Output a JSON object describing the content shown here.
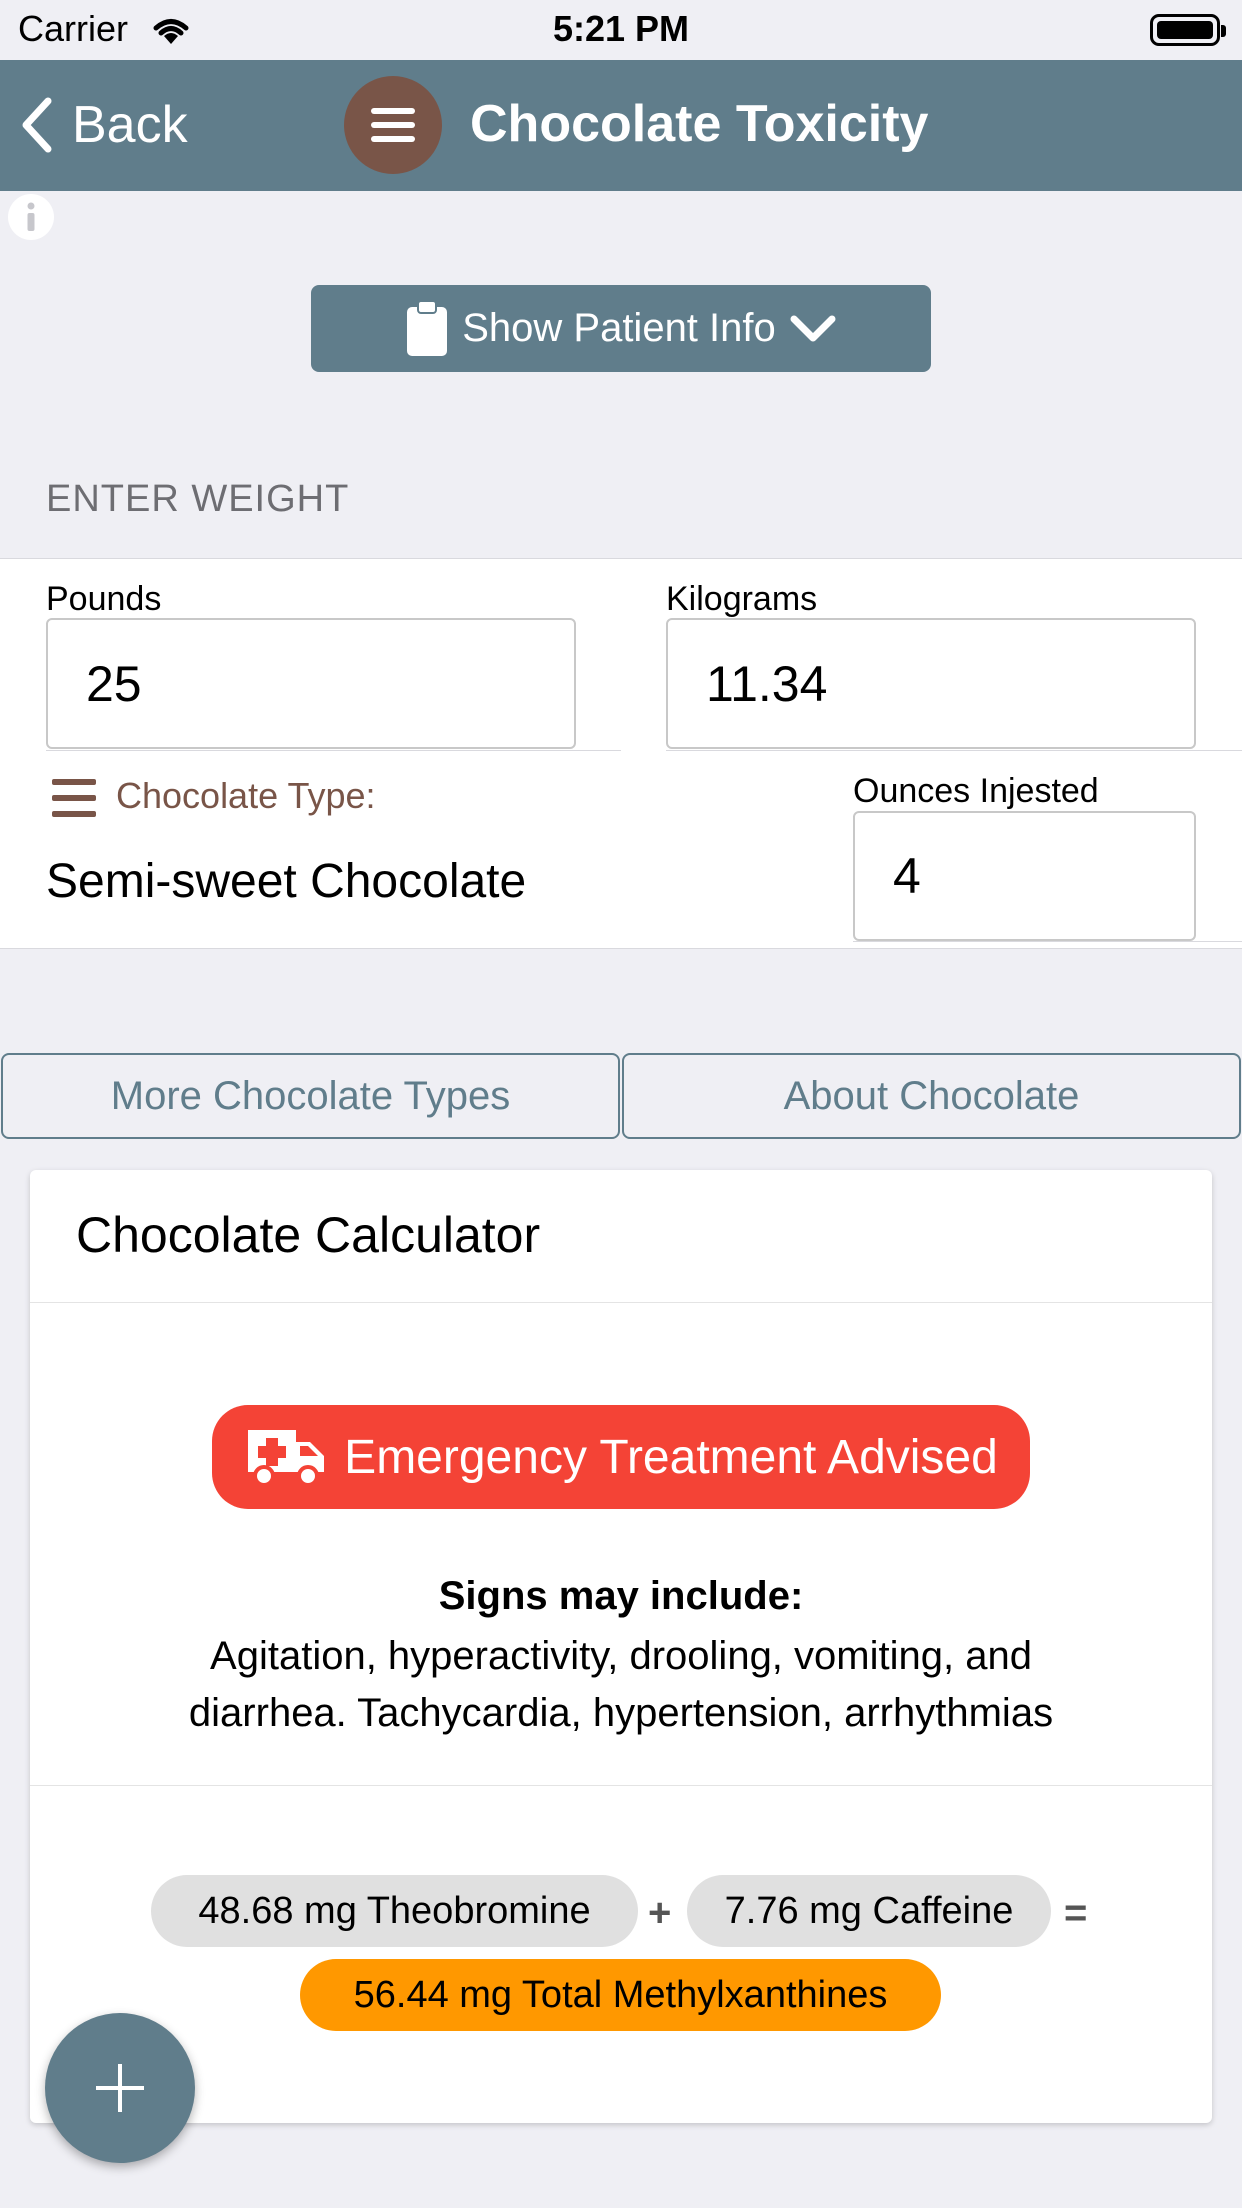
{
  "status_bar": {
    "carrier": "Carrier",
    "time": "5:21 PM"
  },
  "nav": {
    "back_label": "Back",
    "title": "Chocolate Toxicity"
  },
  "patient_button": {
    "label": "Show Patient Info"
  },
  "weight_section": {
    "header": "ENTER WEIGHT",
    "pounds_label": "Pounds",
    "pounds_value": "25",
    "kilograms_label": "Kilograms",
    "kilograms_value": "11.34",
    "chocolate_type_label": "Chocolate Type:",
    "chocolate_type_value": "Semi-sweet Chocolate",
    "ounces_label": "Ounces Injested",
    "ounces_value": "4"
  },
  "buttons": {
    "more_types": "More Chocolate Types",
    "about": "About Chocolate"
  },
  "calculator": {
    "title": "Chocolate Calculator",
    "alert": "Emergency Treatment Advised",
    "signs_title": "Signs may include:",
    "signs_text": "Agitation, hyperactivity, drooling, vomiting, and diarrhea. Tachycardia, hypertension, arrhythmias",
    "theobromine": "48.68 mg Theobromine",
    "plus": "+",
    "caffeine": "7.76 mg Caffeine",
    "equals": "=",
    "total": "56.44 mg Total Methylxanthines"
  },
  "colors": {
    "nav_bar": "#607d8b",
    "menu_circle": "#795548",
    "alert": "#f44336",
    "total_chip": "#ff9800",
    "chip": "#e0e0e0"
  },
  "icons": [
    "wifi-icon",
    "battery-icon",
    "back-chevron-icon",
    "menu-icon",
    "info-icon",
    "clipboard-icon",
    "chevron-down-icon",
    "list-icon",
    "ambulance-icon",
    "plus-icon"
  ]
}
